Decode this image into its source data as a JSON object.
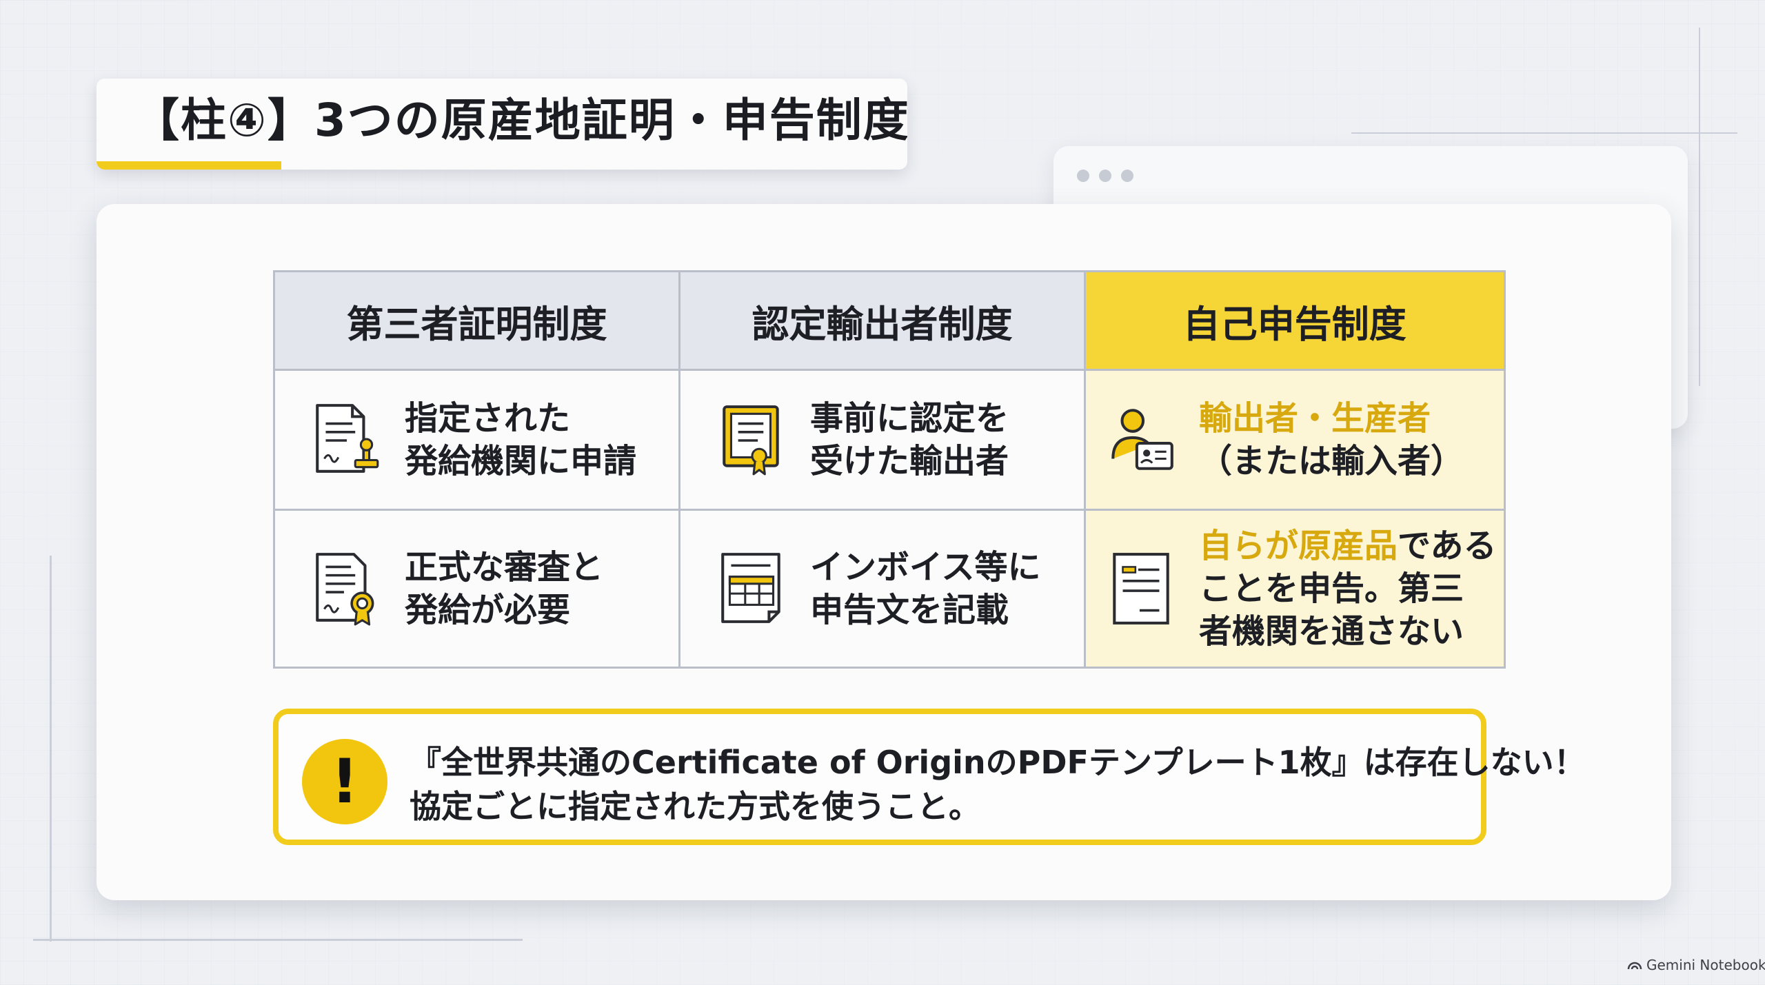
{
  "title": "【柱④】3つの原産地証明・申告制度",
  "table": {
    "headers": [
      "第三者証明制度",
      "認定輸出者制度",
      "自己申告制度"
    ],
    "rows": [
      [
        {
          "icon": "stamped-document-icon",
          "lines": [
            "指定された",
            "発給機関に申請"
          ]
        },
        {
          "icon": "certificate-icon",
          "lines": [
            "事前に認定を",
            "受けた輸出者"
          ]
        },
        {
          "icon": "person-id-card-icon",
          "lines": [
            "輸出者・生産者",
            "（または輸入者）"
          ]
        }
      ],
      [
        {
          "icon": "document-seal-icon",
          "lines": [
            "正式な審査と",
            "発給が必要"
          ]
        },
        {
          "icon": "invoice-icon",
          "lines": [
            "インボイス等に",
            "申告文を記載"
          ]
        },
        {
          "icon": "declaration-document-icon",
          "line1_accent": "自らが原産品",
          "line1_rest": "である",
          "line2": "ことを申告。第三",
          "line3": "者機関を通さない"
        }
      ]
    ]
  },
  "warning": {
    "icon": "exclamation-icon",
    "symbol": "!",
    "line1": "『全世界共通のCertificate of OriginのPDFテンプレート1枚』は存在しない！",
    "line2": "協定ごとに指定された方式を使うこと。"
  },
  "brand": "Gemini Notebook",
  "colors": {
    "accent": "#f2cc1d",
    "accent_text": "#d7a90e",
    "header_bg": "#e3e6ed",
    "highlight_bg": "#fcf5d6"
  }
}
